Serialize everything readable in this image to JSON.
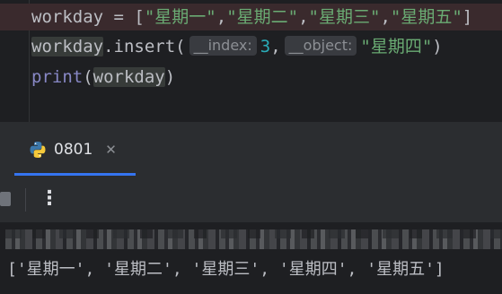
{
  "editor": {
    "line1": {
      "var": "workday",
      "op": " = ",
      "open": "[",
      "items": [
        "\"星期一\"",
        "\"星期二\"",
        "\"星期三\"",
        "\"星期五\""
      ],
      "sep": ",",
      "close": "]"
    },
    "line2": {
      "var": "workday",
      "method": ".insert(",
      "hint_index": "__index:",
      "arg_index": "3",
      "comma": ",",
      "hint_object": "__object:",
      "arg_object": "\"星期四\"",
      "close": ")"
    },
    "line3": {
      "builtin": "print",
      "open": "(",
      "arg": "workday",
      "close": ")"
    }
  },
  "run_window": {
    "tab_label": "0801",
    "close_glyph": "✕",
    "kebab_glyph": "⋮",
    "icons": [
      "python-icon",
      "close-icon",
      "stop-icon",
      "more-options-icon"
    ]
  },
  "console": {
    "output": "['星期一', '星期二', '星期三', '星期四', '星期五']"
  },
  "colors": {
    "string": "#6aab73",
    "number": "#2aacb8",
    "builtin": "#8888c6",
    "accent": "#3574f0"
  }
}
